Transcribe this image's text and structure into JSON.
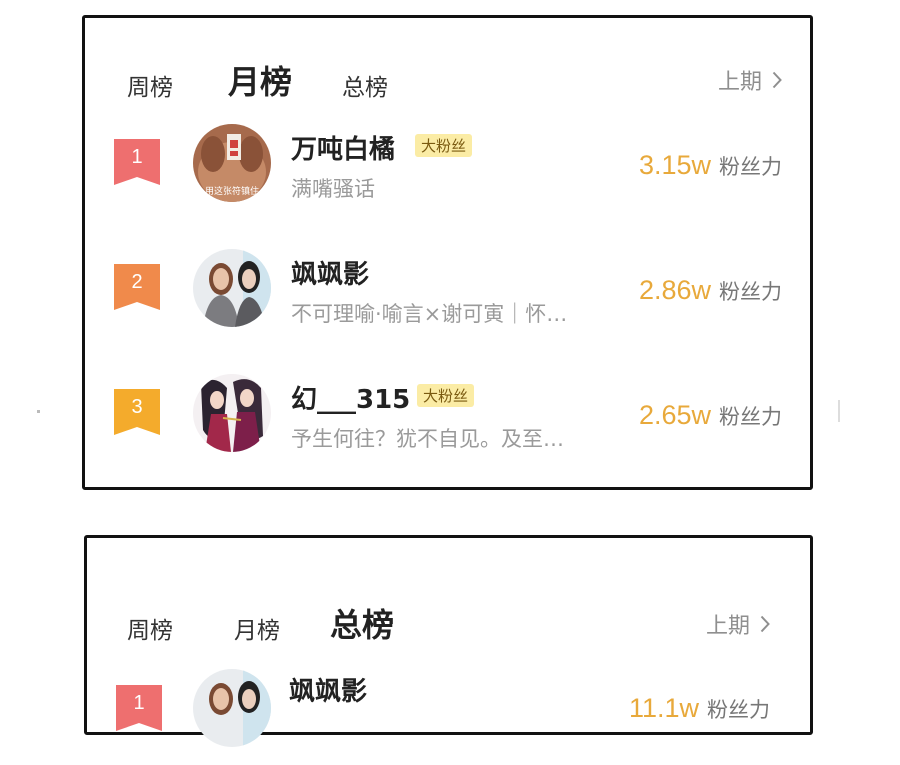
{
  "colors": {
    "rank1": "#ee6f6f",
    "rank2": "#f08a4b",
    "rank3": "#f4ab2c",
    "fans_value": "#e8a93b",
    "badge_bg": "#fbeca5"
  },
  "card1": {
    "tabs": {
      "week": "周榜",
      "month": "月榜",
      "total": "总榜",
      "active": "month"
    },
    "prev_label": "上期",
    "rows": [
      {
        "rank": "1",
        "name": "万吨白橘",
        "badge": "大粉丝",
        "bio": "满嘴骚话",
        "fans_value": "3.15w",
        "fans_label": "粉丝力",
        "avatar_caption": "用这张符镇住"
      },
      {
        "rank": "2",
        "name": "飒飒影",
        "badge": "",
        "bio": "不可理喻·喻言×谢可寅｜怀…",
        "fans_value": "2.86w",
        "fans_label": "粉丝力",
        "avatar_caption": ""
      },
      {
        "rank": "3",
        "name": "幻___315",
        "badge": "大粉丝",
        "bio": "予生何往？犹不自见。及至…",
        "fans_value": "2.65w",
        "fans_label": "粉丝力",
        "avatar_caption": ""
      }
    ]
  },
  "card2": {
    "tabs": {
      "week": "周榜",
      "month": "月榜",
      "total": "总榜",
      "active": "total"
    },
    "prev_label": "上期",
    "rows": [
      {
        "rank": "1",
        "name": "飒飒影",
        "fans_value": "11.1w",
        "fans_label": "粉丝力"
      }
    ]
  }
}
